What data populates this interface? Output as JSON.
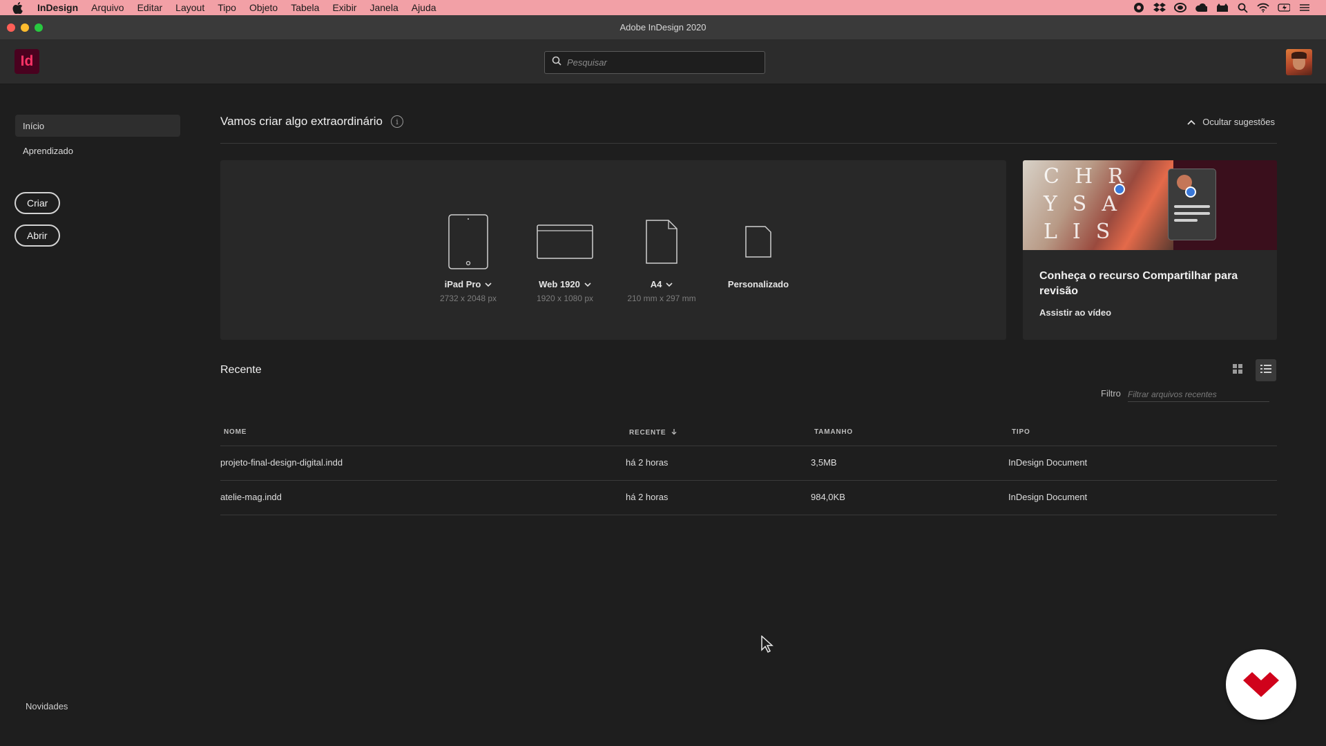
{
  "menubar": {
    "app": "InDesign",
    "items": [
      "Arquivo",
      "Editar",
      "Layout",
      "Tipo",
      "Objeto",
      "Tabela",
      "Exibir",
      "Janela",
      "Ajuda"
    ]
  },
  "window": {
    "title": "Adobe InDesign 2020"
  },
  "header": {
    "logo": "Id",
    "search_placeholder": "Pesquisar"
  },
  "sidebar": {
    "items": [
      {
        "label": "Início",
        "active": true
      },
      {
        "label": "Aprendizado",
        "active": false
      }
    ],
    "create_label": "Criar",
    "open_label": "Abrir",
    "news_label": "Novidades"
  },
  "main": {
    "title": "Vamos criar algo extraordinário",
    "hide_suggestions": "Ocultar sugestões",
    "presets": [
      {
        "name": "iPad Pro",
        "size": "2732 x 2048 px",
        "dropdown": true
      },
      {
        "name": "Web 1920",
        "size": "1920 x 1080 px",
        "dropdown": true
      },
      {
        "name": "A4",
        "size": "210 mm x 297 mm",
        "dropdown": true
      },
      {
        "name": "Personalizado",
        "size": "",
        "dropdown": false
      }
    ],
    "promo": {
      "image_text": "C H R\nY S A\nL I S",
      "title": "Conheça o recurso Compartilhar para revisão",
      "link": "Assistir ao vídeo"
    }
  },
  "recent": {
    "title": "Recente",
    "filter_label": "Filtro",
    "filter_placeholder": "Filtrar arquivos recentes",
    "columns": {
      "name": "NOME",
      "recent": "RECENTE",
      "size": "TAMANHO",
      "type": "TIPO"
    },
    "rows": [
      {
        "name": "projeto-final-design-digital.indd",
        "recent": "há 2 horas",
        "size": "3,5MB",
        "type": "InDesign Document"
      },
      {
        "name": "atelie-mag.indd",
        "recent": "há 2 horas",
        "size": "984,0KB",
        "type": "InDesign Document"
      }
    ]
  },
  "colors": {
    "menubar": "#f2a0a6",
    "background": "#1e1e1e",
    "panel": "#282828",
    "indesign_brand": "#ff3366",
    "badge_brand": "#d0021b"
  }
}
